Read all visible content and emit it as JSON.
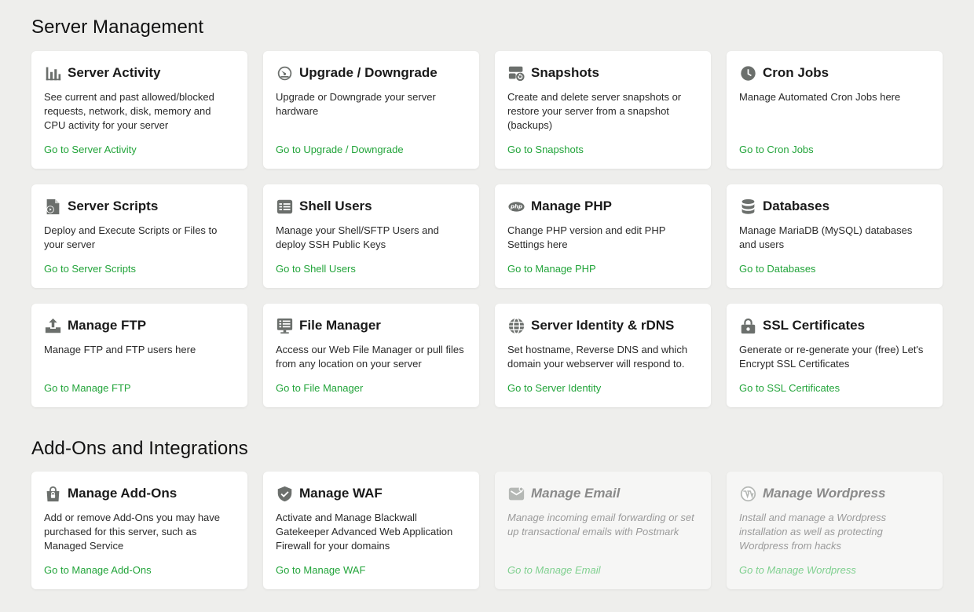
{
  "sections": [
    {
      "title": "Server Management",
      "cards": [
        {
          "icon": "bar-chart-icon",
          "title": "Server Activity",
          "desc": "See current and past allowed/blocked requests, network, disk, memory and CPU activity for your server",
          "link": "Go to Server Activity",
          "disabled": false
        },
        {
          "icon": "speedometer-icon",
          "title": "Upgrade / Downgrade",
          "desc": "Upgrade or Downgrade your server hardware",
          "link": "Go to Upgrade / Downgrade",
          "disabled": false
        },
        {
          "icon": "snapshot-icon",
          "title": "Snapshots",
          "desc": "Create and delete server snapshots or restore your server from a snapshot (backups)",
          "link": "Go to Snapshots",
          "disabled": false
        },
        {
          "icon": "clock-icon",
          "title": "Cron Jobs",
          "desc": "Manage Automated Cron Jobs here",
          "link": "Go to Cron Jobs",
          "disabled": false
        },
        {
          "icon": "script-file-icon",
          "title": "Server Scripts",
          "desc": "Deploy and Execute Scripts or Files to your server",
          "link": "Go to Server Scripts",
          "disabled": false
        },
        {
          "icon": "terminal-users-icon",
          "title": "Shell Users",
          "desc": "Manage your Shell/SFTP Users and deploy SSH Public Keys",
          "link": "Go to Shell Users",
          "disabled": false
        },
        {
          "icon": "php-icon",
          "title": "Manage PHP",
          "desc": "Change PHP version and edit PHP Settings here",
          "link": "Go to Manage PHP",
          "disabled": false
        },
        {
          "icon": "database-icon",
          "title": "Databases",
          "desc": "Manage MariaDB (MySQL) databases and users",
          "link": "Go to Databases",
          "disabled": false
        },
        {
          "icon": "upload-icon",
          "title": "Manage FTP",
          "desc": "Manage FTP and FTP users here",
          "link": "Go to Manage FTP",
          "disabled": false
        },
        {
          "icon": "file-manager-icon",
          "title": "File Manager",
          "desc": "Access our Web File Manager or pull files from any location on your server",
          "link": "Go to File Manager",
          "disabled": false
        },
        {
          "icon": "globe-icon",
          "title": "Server Identity & rDNS",
          "desc": "Set hostname, Reverse DNS and which domain your webserver will respond to.",
          "link": "Go to Server Identity",
          "disabled": false
        },
        {
          "icon": "lock-icon",
          "title": "SSL Certificates",
          "desc": "Generate or re-generate your (free) Let's Encrypt SSL Certificates",
          "link": "Go to SSL Certificates",
          "disabled": false
        }
      ]
    },
    {
      "title": "Add-Ons and Integrations",
      "cards": [
        {
          "icon": "bag-lock-icon",
          "title": "Manage Add-Ons",
          "desc": "Add or remove Add-Ons you may have purchased for this server, such as Managed Service",
          "link": "Go to Manage Add-Ons",
          "disabled": false
        },
        {
          "icon": "shield-check-icon",
          "title": "Manage WAF",
          "desc": "Activate and Manage Blackwall Gatekeeper Advanced Web Application Firewall for your domains",
          "link": "Go to Manage WAF",
          "disabled": false
        },
        {
          "icon": "mail-icon",
          "title": "Manage Email",
          "desc": "Manage incoming email forwarding or set up transactional emails with Postmark",
          "link": "Go to Manage Email",
          "disabled": true
        },
        {
          "icon": "wordpress-icon",
          "title": "Manage Wordpress",
          "desc": "Install and manage a Wordpress installation as well as protecting Wordpress from hacks",
          "link": "Go to Manage Wordpress",
          "disabled": true
        }
      ]
    }
  ]
}
